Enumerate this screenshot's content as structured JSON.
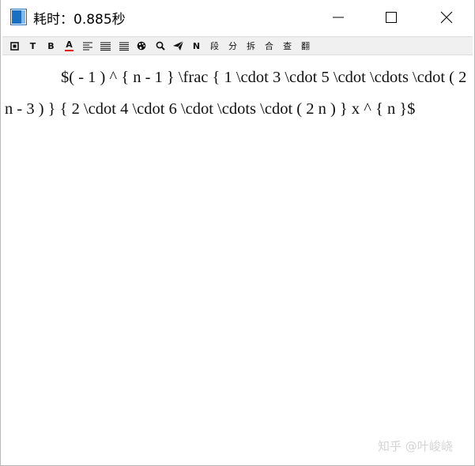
{
  "window": {
    "title": "耗时：0.885秒"
  },
  "toolbar": {
    "items": [
      {
        "name": "box-icon",
        "glyph": "▣"
      },
      {
        "name": "text-icon",
        "glyph": "T"
      },
      {
        "name": "bold-icon",
        "glyph": "B"
      },
      {
        "name": "font-color-icon",
        "glyph": "A"
      },
      {
        "name": "align-left-icon",
        "glyph": "≡"
      },
      {
        "name": "align-center-icon",
        "glyph": "≡"
      },
      {
        "name": "align-justify-icon",
        "glyph": "≡"
      },
      {
        "name": "palette-icon",
        "glyph": "❦"
      },
      {
        "name": "search-icon",
        "glyph": "⚲"
      },
      {
        "name": "send-icon",
        "glyph": "➤"
      },
      {
        "name": "n-icon",
        "glyph": "N"
      }
    ],
    "text_buttons": [
      "段",
      "分",
      "拆",
      "合",
      "查",
      "翻"
    ]
  },
  "content": {
    "text": "$( - 1 ) ^ { n - 1 } \\frac { 1 \\cdot 3 \\cdot 5 \\cdot \\cdots \\cdot ( 2 n - 3 ) } { 2 \\cdot 4 \\cdot 6 \\cdot \\cdots \\cdot ( 2 n ) } x ^ { n }$"
  },
  "watermark": {
    "text": "知乎 @叶峻峣"
  },
  "colors": {
    "font_color_underline": "#e02020",
    "icon_blue": "#1b6fc2",
    "icon_light": "#7fb8ea"
  }
}
